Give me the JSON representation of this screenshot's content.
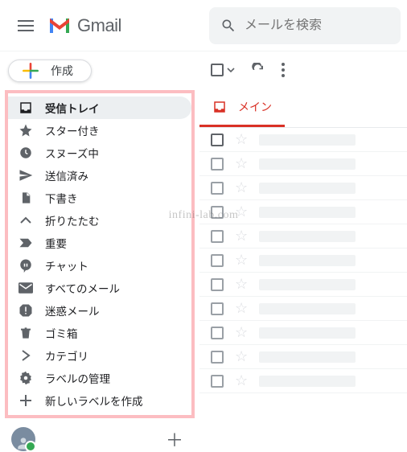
{
  "header": {
    "app_name": "Gmail",
    "search_placeholder": "メールを検索"
  },
  "compose_label": "作成",
  "sidebar": {
    "items": [
      {
        "icon": "inbox-icon",
        "label": "受信トレイ",
        "active": true
      },
      {
        "icon": "star-icon",
        "label": "スター付き",
        "active": false
      },
      {
        "icon": "clock-icon",
        "label": "スヌーズ中",
        "active": false
      },
      {
        "icon": "send-icon",
        "label": "送信済み",
        "active": false
      },
      {
        "icon": "draft-icon",
        "label": "下書き",
        "active": false
      },
      {
        "icon": "collapse-icon",
        "label": "折りたたむ",
        "active": false
      },
      {
        "icon": "important-icon",
        "label": "重要",
        "active": false
      },
      {
        "icon": "chat-icon",
        "label": "チャット",
        "active": false
      },
      {
        "icon": "allmail-icon",
        "label": "すべてのメール",
        "active": false
      },
      {
        "icon": "spam-icon",
        "label": "迷惑メール",
        "active": false
      },
      {
        "icon": "trash-icon",
        "label": "ゴミ箱",
        "active": false
      },
      {
        "icon": "category-icon",
        "label": "カテゴリ",
        "active": false
      },
      {
        "icon": "settings-icon",
        "label": "ラベルの管理",
        "active": false
      },
      {
        "icon": "plus-icon",
        "label": "新しいラベルを作成",
        "active": false
      }
    ]
  },
  "tab": {
    "label": "メイン"
  },
  "row_count": 11,
  "watermark": "infini-lab.com"
}
